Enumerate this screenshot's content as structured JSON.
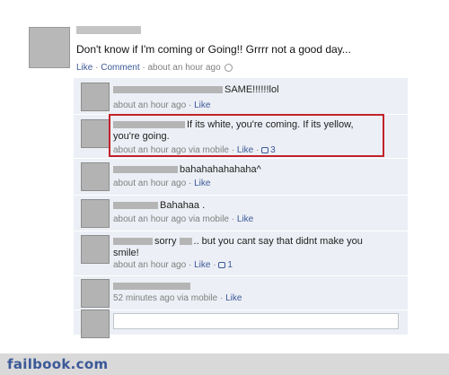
{
  "post": {
    "text": "Don't know if I'm coming or Going!! Grrrr not a good day...",
    "like": "Like",
    "comment": "Comment",
    "time": "about an hour ago"
  },
  "comments": [
    {
      "text": "SAME!!!!!!lol",
      "time": "about an hour ago",
      "via": "",
      "like": "Like",
      "likes": ""
    },
    {
      "text": "If its white, you're coming. If its yellow, you're going.",
      "time": "about an hour ago",
      "via": "via mobile",
      "like": "Like",
      "likes": "3"
    },
    {
      "text": "bahahahahahaha^",
      "time": "about an hour ago",
      "via": "",
      "like": "Like",
      "likes": ""
    },
    {
      "text": "Bahahaa .",
      "time": "about an hour ago",
      "via": "via mobile",
      "like": "Like",
      "likes": ""
    },
    {
      "text": "sorry",
      "text2": ".. but you cant say that didnt make you smile!",
      "time": "about an hour ago",
      "via": "",
      "like": "Like",
      "likes": "1"
    },
    {
      "text": "",
      "time": "52 minutes ago",
      "via": "via mobile",
      "like": "Like",
      "likes": ""
    }
  ],
  "footer": {
    "site": "failbook.com"
  },
  "colors": {
    "link": "#3b5998",
    "highlight": "#c2222b",
    "thread_bg": "#eceff5"
  }
}
